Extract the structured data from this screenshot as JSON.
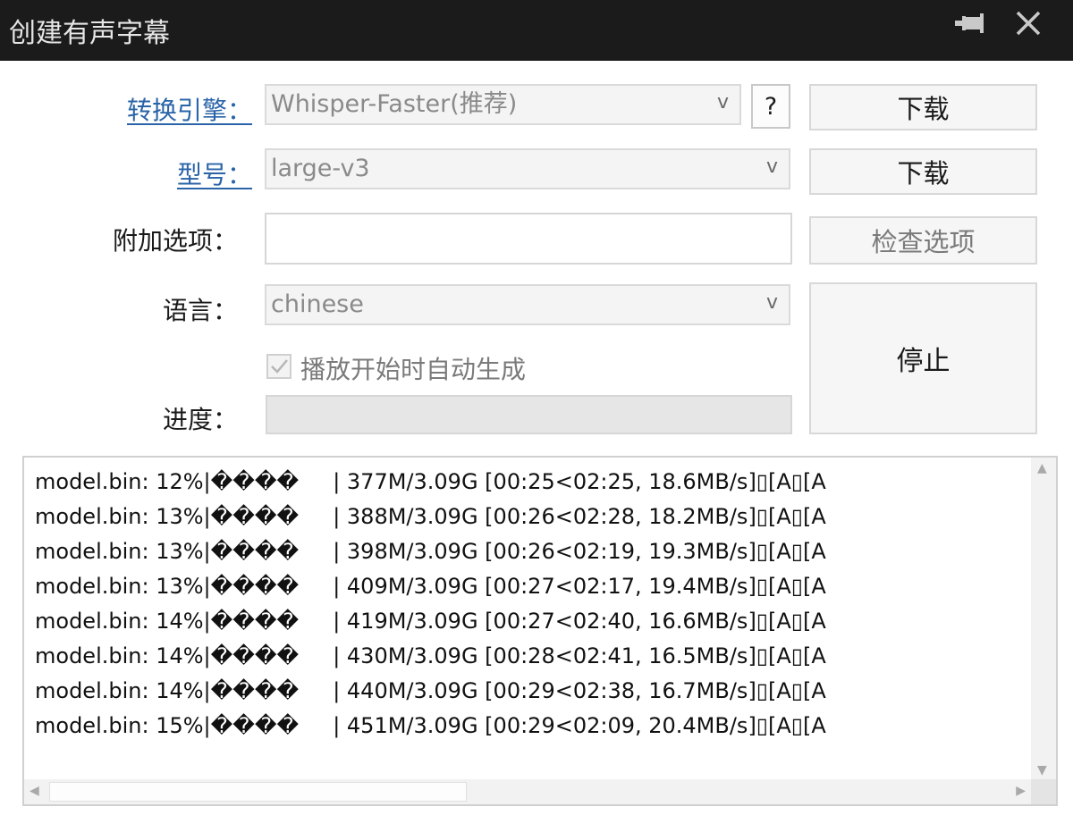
{
  "window": {
    "title": "创建有声字幕"
  },
  "form": {
    "engine": {
      "label": "转换引擎：",
      "value": "Whisper-Faster(推荐)",
      "arrow": "v",
      "help_label": "?",
      "download_label": "下载"
    },
    "model": {
      "label": "型号：",
      "value": "large-v3",
      "arrow": "v",
      "download_label": "下载"
    },
    "options": {
      "label": "附加选项：",
      "value": "",
      "check_label": "检查选项"
    },
    "language": {
      "label": "语言：",
      "value": "chinese",
      "arrow": "v"
    },
    "autogen": {
      "label": "播放开始时自动生成",
      "checked": true
    },
    "progress": {
      "label": "进度：",
      "value": 0
    },
    "stop_label": "停止"
  },
  "log": {
    "lines": [
      "model.bin: 12%|����     | 377M/3.09G [00:25<02:25, 18.6MB/s]\u001b[A\u001b[A",
      "model.bin: 13%|����     | 388M/3.09G [00:26<02:28, 18.2MB/s]\u001b[A\u001b[A",
      "model.bin: 13%|����     | 398M/3.09G [00:26<02:19, 19.3MB/s]\u001b[A\u001b[A",
      "model.bin: 13%|����     | 409M/3.09G [00:27<02:17, 19.4MB/s]\u001b[A\u001b[A",
      "model.bin: 14%|����     | 419M/3.09G [00:27<02:40, 16.6MB/s]\u001b[A\u001b[A",
      "model.bin: 14%|����     | 430M/3.09G [00:28<02:41, 16.5MB/s]\u001b[A\u001b[A",
      "model.bin: 14%|����     | 440M/3.09G [00:29<02:38, 16.7MB/s]\u001b[A\u001b[A",
      "model.bin: 15%|����     | 451M/3.09G [00:29<02:09, 20.4MB/s]\u001b[A\u001b[A"
    ],
    "horizontal_scroll_fraction": 0.41,
    "scroll": {
      "up": "▲",
      "down": "▼",
      "left": "◀",
      "right": "▶"
    }
  },
  "icons": {
    "pin": "pin-icon",
    "close": "close-icon",
    "check": "check-icon"
  },
  "colors": {
    "link": "#2a64a8",
    "titlebar": "#1b1b1b"
  }
}
